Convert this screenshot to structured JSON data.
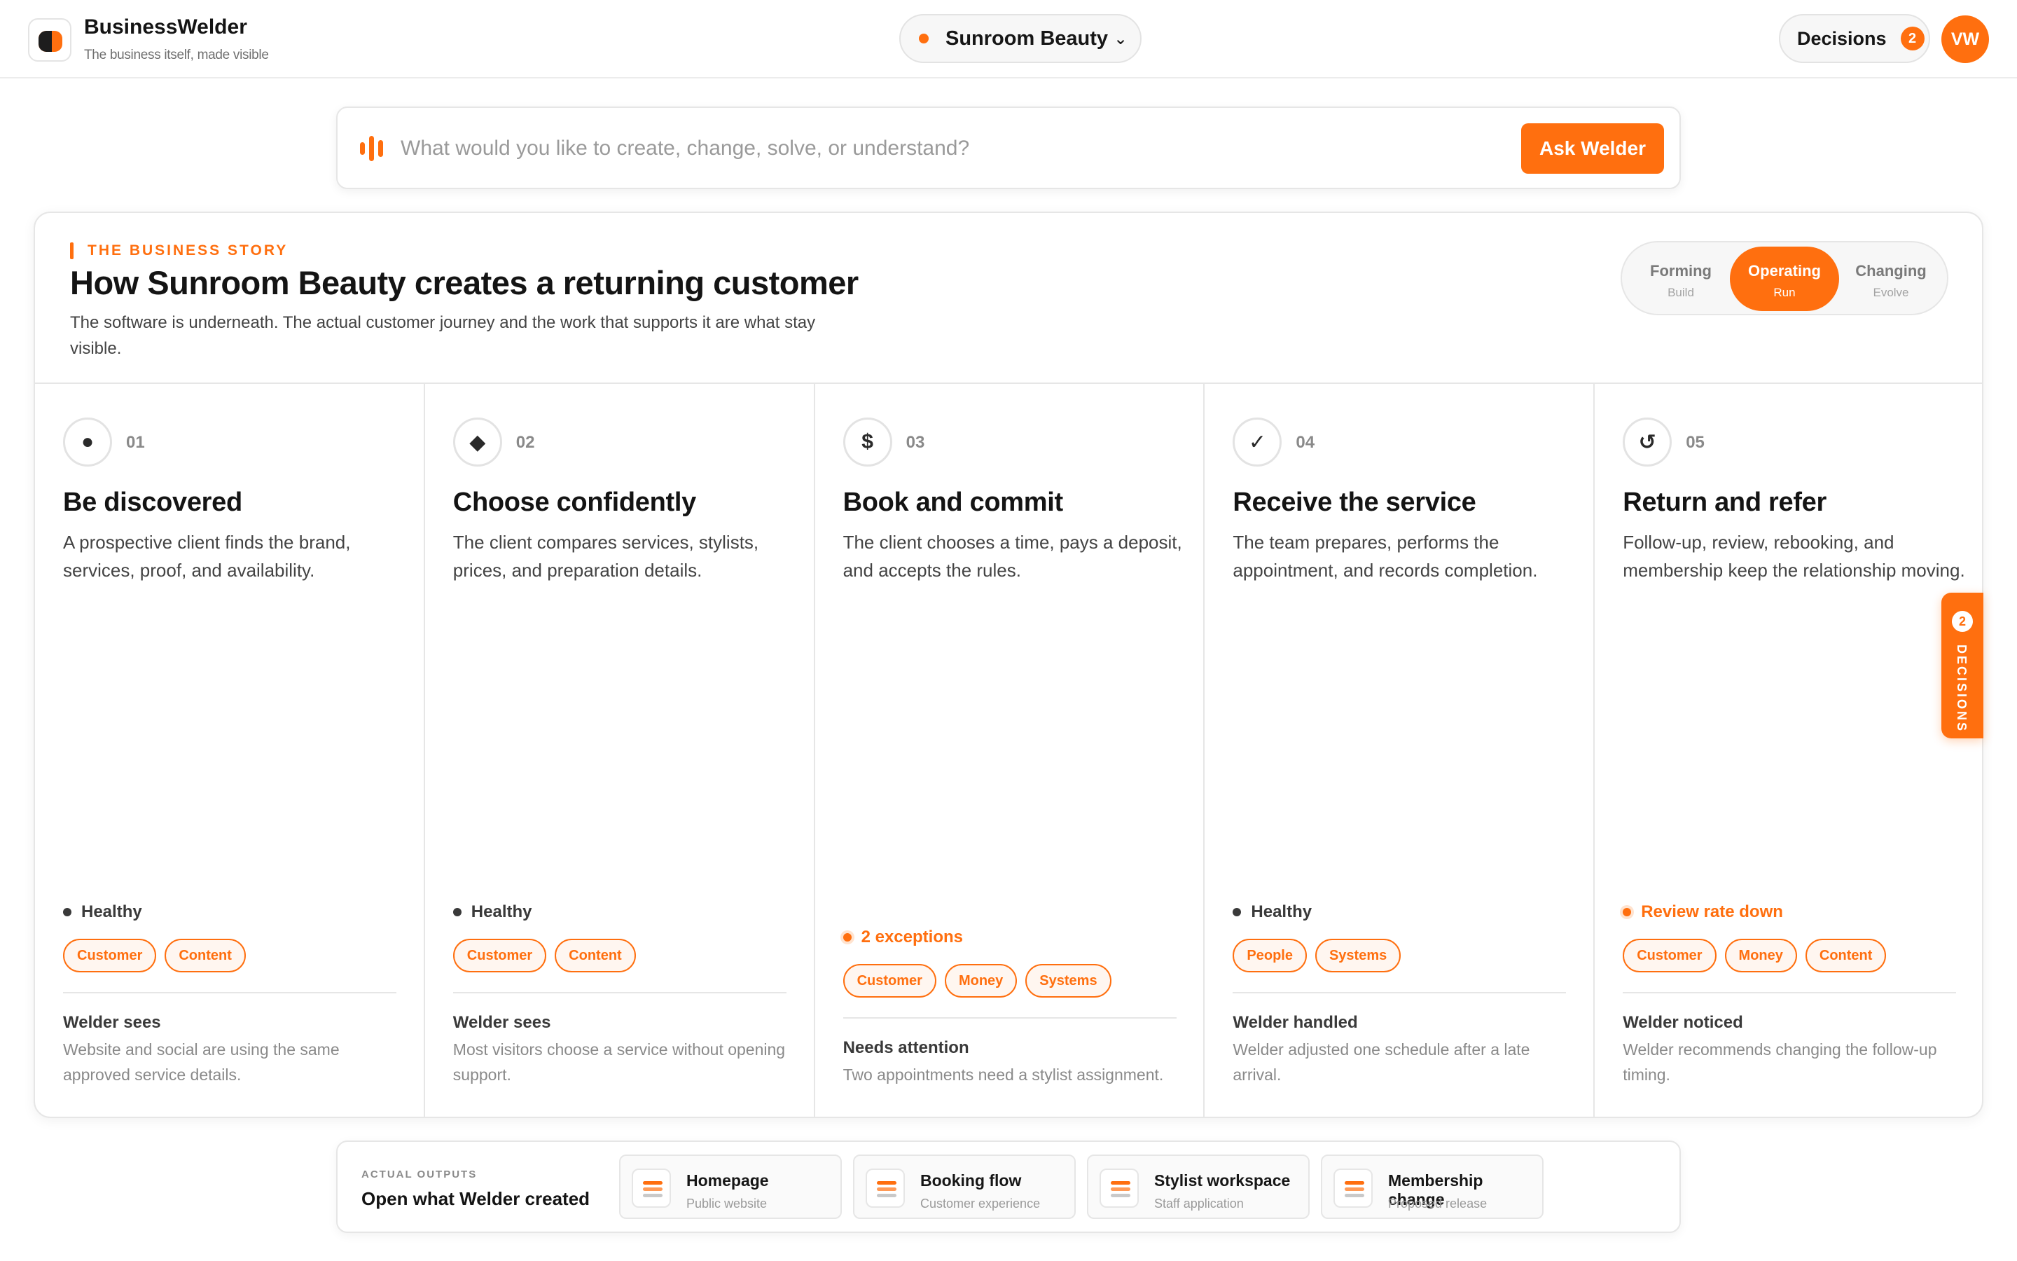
{
  "app": {
    "name": "BusinessWelder",
    "tagline": "The business itself, made visible"
  },
  "business_selector": {
    "value": "Sunroom Beauty"
  },
  "header": {
    "decisions_label": "Decisions",
    "decisions_count": "2",
    "avatar_initials": "VW"
  },
  "ask": {
    "placeholder": "What would you like to create, change, solve, or understand?",
    "button_label": "Ask Welder"
  },
  "story": {
    "eyebrow": "THE BUSINESS STORY",
    "title": "How Sunroom Beauty creates a returning customer",
    "subtitle": "The software is underneath. The actual customer journey and the work that supports it are what stay visible.",
    "phases": [
      {
        "label": "Forming",
        "sub": "Build",
        "active": false
      },
      {
        "label": "Operating",
        "sub": "Run",
        "active": true
      },
      {
        "label": "Changing",
        "sub": "Evolve",
        "active": false
      }
    ],
    "stages": [
      {
        "icon_name": "dot-icon",
        "icon_glyph": "●",
        "number": "01",
        "title": "Be discovered",
        "description": "A prospective client finds the brand, services, proof, and availability.",
        "status": "Healthy",
        "status_type": "neutral",
        "tags": [
          "Customer",
          "Content"
        ],
        "note_title": "Welder sees",
        "note_text": "Website and social are using the same approved service details."
      },
      {
        "icon_name": "diamond-icon",
        "icon_glyph": "◆",
        "number": "02",
        "title": "Choose confidently",
        "description": "The client compares services, stylists, prices, and preparation details.",
        "status": "Healthy",
        "status_type": "neutral",
        "tags": [
          "Customer",
          "Content"
        ],
        "note_title": "Welder sees",
        "note_text": "Most visitors choose a service without opening support."
      },
      {
        "icon_name": "dollar-icon",
        "icon_glyph": "$",
        "number": "03",
        "title": "Book and commit",
        "description": "The client chooses a time, pays a deposit, and accepts the rules.",
        "status": "2 exceptions",
        "status_type": "warn",
        "tags": [
          "Customer",
          "Money",
          "Systems"
        ],
        "note_title": "Needs attention",
        "note_text": "Two appointments need a stylist assignment."
      },
      {
        "icon_name": "checkmark-icon",
        "icon_glyph": "✓",
        "number": "04",
        "title": "Receive the service",
        "description": "The team prepares, performs the appointment, and records completion.",
        "status": "Healthy",
        "status_type": "neutral",
        "tags": [
          "People",
          "Systems"
        ],
        "note_title": "Welder handled",
        "note_text": "Welder adjusted one schedule after a late arrival."
      },
      {
        "icon_name": "refresh-icon",
        "icon_glyph": "↺",
        "number": "05",
        "title": "Return and refer",
        "description": "Follow-up, review, rebooking, and membership keep the relationship moving.",
        "status": "Review rate down",
        "status_type": "warn",
        "tags": [
          "Customer",
          "Money",
          "Content"
        ],
        "note_title": "Welder noticed",
        "note_text": "Welder recommends changing the follow-up timing."
      }
    ]
  },
  "decisions_tab": {
    "count": "2",
    "label": "DECISIONS"
  },
  "outputs": {
    "eyebrow": "ACTUAL OUTPUTS",
    "title": "Open what Welder created",
    "items": [
      {
        "name": "Homepage",
        "sub": "Public website"
      },
      {
        "name": "Booking flow",
        "sub": "Customer experience"
      },
      {
        "name": "Stylist workspace",
        "sub": "Staff application"
      },
      {
        "name": "Membership change",
        "sub": "Proposed release"
      }
    ]
  },
  "colors": {
    "accent": "#ff6f0f",
    "accent_tint": "#fff6f0",
    "text": "#141414",
    "muted": "#8a8a8a"
  }
}
